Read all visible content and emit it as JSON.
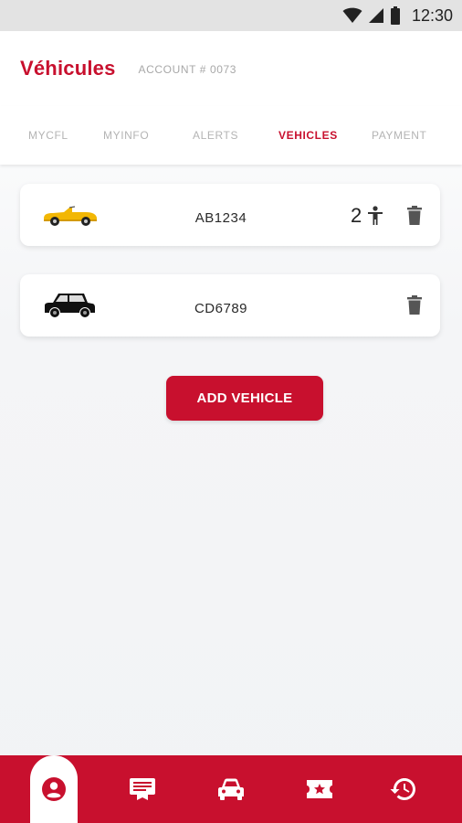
{
  "status_bar": {
    "time": "12:30",
    "icons": [
      "wifi-icon",
      "signal-icon",
      "battery-icon"
    ]
  },
  "header": {
    "title": "Véhicules",
    "account": "ACCOUNT # 0073"
  },
  "tabs": [
    {
      "label": "MYCFL",
      "active": false
    },
    {
      "label": "MYINFO",
      "active": false
    },
    {
      "label": "ALERTS",
      "active": false
    },
    {
      "label": "VEHICLES",
      "active": true
    },
    {
      "label": "PAYMENT",
      "active": false
    }
  ],
  "vehicles": [
    {
      "plate": "AB1234",
      "passengers": "2",
      "icon": "yellow-convertible-car",
      "color": "#f2b705"
    },
    {
      "plate": "CD6789",
      "passengers": "",
      "icon": "black-suv-car",
      "color": "#111111"
    }
  ],
  "add_button": {
    "label": "ADD VEHICLE"
  },
  "bottom_nav": [
    {
      "icon": "account-icon",
      "active": true
    },
    {
      "icon": "ticket-icon",
      "active": false
    },
    {
      "icon": "car-icon",
      "active": false
    },
    {
      "icon": "star-ticket-icon",
      "active": false
    },
    {
      "icon": "history-icon",
      "active": false
    }
  ],
  "colors": {
    "brand": "#c8102e",
    "tab_inactive": "#b4b4b4",
    "status_bar": "#e3e3e3"
  }
}
